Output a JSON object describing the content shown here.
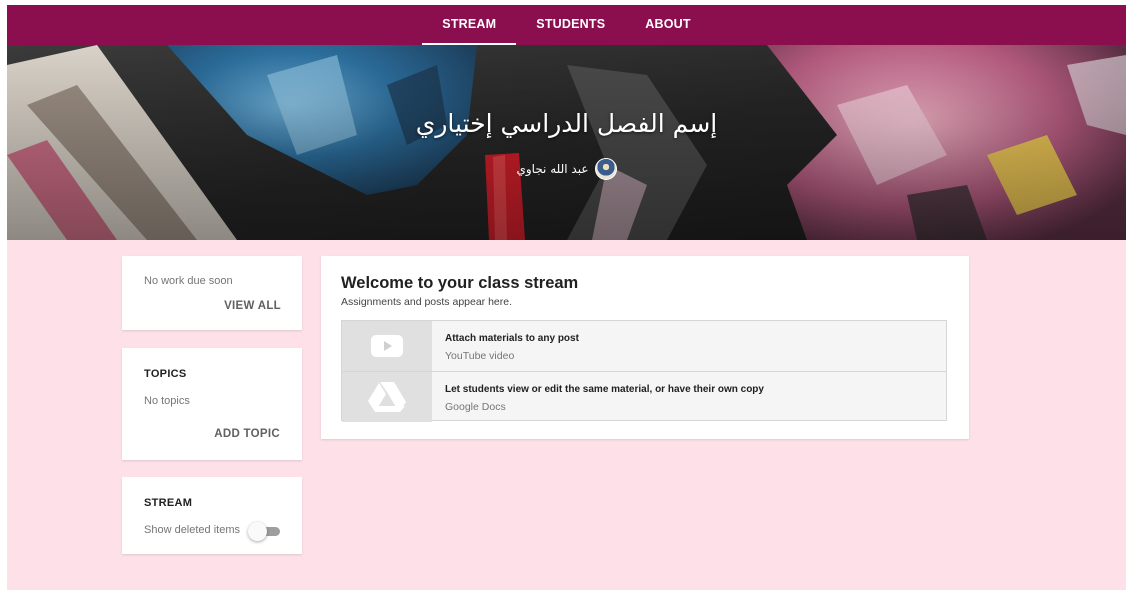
{
  "nav": {
    "tabs": [
      {
        "label": "STREAM",
        "active": true
      },
      {
        "label": "STUDENTS",
        "active": false
      },
      {
        "label": "ABOUT",
        "active": false
      }
    ]
  },
  "banner": {
    "class_title": "إسم الفصل الدراسي إختياري",
    "teacher_name": "عبد الله نجاوي"
  },
  "upcoming": {
    "empty_text": "No work due soon",
    "view_all_label": "VIEW ALL"
  },
  "topics": {
    "heading": "TOPICS",
    "empty_text": "No topics",
    "add_label": "ADD TOPIC"
  },
  "stream_settings": {
    "heading": "STREAM",
    "toggle_label": "Show deleted items",
    "toggle_on": false
  },
  "welcome": {
    "title": "Welcome to your class stream",
    "subtitle": "Assignments and posts appear here.",
    "tips": [
      {
        "title": "Attach materials to any post",
        "subtitle": "YouTube video",
        "icon": "youtube-icon"
      },
      {
        "title": "Let students view or edit the same material, or have their own copy",
        "subtitle": "Google Docs",
        "icon": "google-drive-icon"
      }
    ]
  },
  "colors": {
    "nav_bg": "#8b0f4f",
    "page_bg": "#fde0e8",
    "card_bg": "#ffffff"
  }
}
